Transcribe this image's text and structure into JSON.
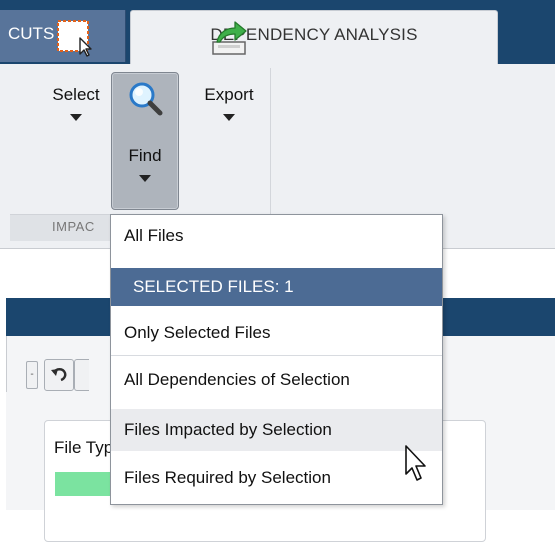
{
  "tabs": [
    {
      "label": "CUTS",
      "active": false
    },
    {
      "label": "DEPENDENCY ANALYSIS",
      "active": true
    }
  ],
  "toolbar": {
    "select": {
      "label": "Select",
      "icon": "select-icon"
    },
    "find": {
      "label": "Find",
      "icon": "magnifier-icon",
      "pressed": true
    },
    "export": {
      "label": "Export",
      "icon": "export-icon"
    },
    "group_label": "IMPAC"
  },
  "find_menu": {
    "items": [
      {
        "label": "All Files"
      },
      {
        "label": "SELECTED FILES: 1",
        "header": true
      },
      {
        "label": "Only Selected Files"
      },
      {
        "label": "All Dependencies of Selection"
      },
      {
        "label": "Files Impacted by Selection",
        "hovered": true
      },
      {
        "label": "Files Required by Selection"
      }
    ]
  },
  "panel": {
    "legend_label": "File Type",
    "legend_color": "#7be3a0"
  },
  "colors": {
    "tab_strip": "#1b466e",
    "menu_header": "#4c6b94",
    "ribbon": "#eef0f3"
  }
}
